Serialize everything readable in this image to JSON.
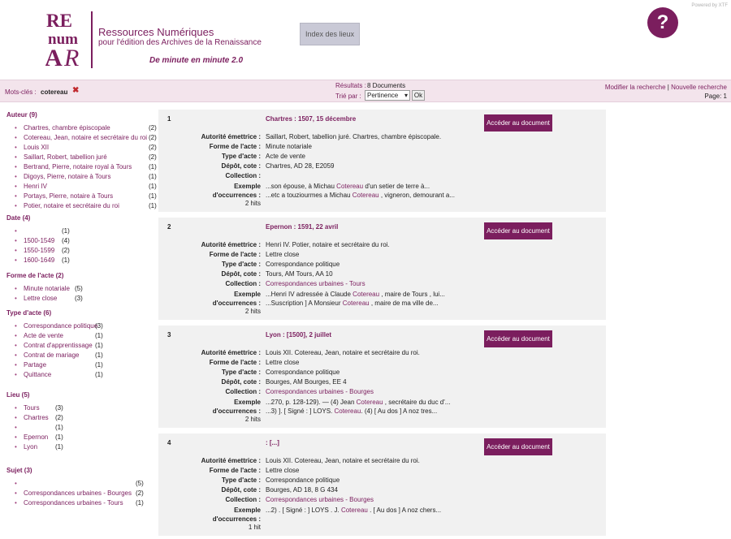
{
  "header": {
    "title": "Ressources Numériques",
    "subtitle": "pour l'édition des Archives de la Renaissance",
    "tagline": "De minute en minute 2.0",
    "index_button": "Index des lieux",
    "help_button": "?",
    "powered": "Powered by XTF"
  },
  "search": {
    "keywords_label": "Mots-clés :",
    "keyword": "cotereau",
    "remove": "✖",
    "results_label": "Résultats :",
    "results_value": "8 Documents",
    "sort_label": "Trié par :",
    "sort_value": "Pertinence",
    "ok": "Ok",
    "modify": "Modifier la recherche",
    "separator": "|",
    "new_search": "Nouvelle recherche",
    "page": "Page: 1"
  },
  "facets": [
    {
      "title": "Auteur (9)",
      "items": [
        {
          "label": "Chartres, chambre épiscopale",
          "count": "(2)"
        },
        {
          "label": "Cotereau, Jean, notaire et secrétaire du roi",
          "count": "(2)"
        },
        {
          "label": "Louis XII",
          "count": "(2)"
        },
        {
          "label": "Saillart, Robert, tabellion juré",
          "count": "(2)"
        },
        {
          "label": "Bertrand, Pierre, notaire royal à Tours",
          "count": "(1)"
        },
        {
          "label": "Digoys, Pierre, notaire à Tours",
          "count": "(1)"
        },
        {
          "label": "Henri IV",
          "count": "(1)"
        },
        {
          "label": "Portays, Pierre, notaire à Tours",
          "count": "(1)"
        },
        {
          "label": "Potier, notaire et secrétaire du roi",
          "count": "(1)"
        }
      ]
    },
    {
      "title": "Date (4)",
      "items": [
        {
          "label": "",
          "count": "(1)"
        },
        {
          "label": "1500-1549",
          "count": "(4)"
        },
        {
          "label": "1550-1599",
          "count": "(2)"
        },
        {
          "label": "1600-1649",
          "count": "(1)"
        }
      ]
    },
    {
      "title": "Forme de l'acte (2)",
      "items": [
        {
          "label": "Minute notariale",
          "count": "(5)"
        },
        {
          "label": "Lettre close",
          "count": "(3)"
        }
      ]
    },
    {
      "title": "Type d'acte (6)",
      "items": [
        {
          "label": "Correspondance politique",
          "count": "(3)"
        },
        {
          "label": "Acte de vente",
          "count": "(1)"
        },
        {
          "label": "Contrat d'apprentissage",
          "count": "(1)"
        },
        {
          "label": "Contrat de mariage",
          "count": "(1)"
        },
        {
          "label": "Partage",
          "count": "(1)"
        },
        {
          "label": "Quittance",
          "count": "(1)"
        }
      ]
    },
    {
      "title": "Lieu (5)",
      "items": [
        {
          "label": "Tours",
          "count": "(3)"
        },
        {
          "label": "Chartres",
          "count": "(2)"
        },
        {
          "label": "",
          "count": "(1)"
        },
        {
          "label": "Epernon",
          "count": "(1)"
        },
        {
          "label": "Lyon",
          "count": "(1)"
        }
      ]
    },
    {
      "title": "Sujet (3)",
      "items": [
        {
          "label": "",
          "count": "(5)"
        },
        {
          "label": "Correspondances urbaines - Bourges",
          "count": "(2)"
        },
        {
          "label": "Correspondances urbaines - Tours",
          "count": "(1)"
        }
      ]
    }
  ],
  "field_labels": {
    "autorite": "Autorité émettrice :",
    "forme": "Forme de l'acte :",
    "type": "Type d'acte :",
    "depot": "Dépôt, cote :",
    "collection": "Collection :",
    "exemple": "Exemple",
    "occurrences": "d'occurrences :"
  },
  "access_button": "Accéder au document",
  "results": [
    {
      "num": "1",
      "title": "Chartres : 1507, 15 décembre",
      "autorite": "Saillart, Robert, tabellion juré. Chartres, chambre épiscopale.",
      "forme": "Minute notariale",
      "type": "Acte de vente",
      "depot": "Chartres, AD 28, E2059",
      "collection": "",
      "snippets": [
        {
          "pre": "...son épouse, à Michau ",
          "kw": "Cotereau",
          "post": " d'un setier de terre à..."
        },
        {
          "pre": "...etc a touziourmes a Michau ",
          "kw": "Cotereau",
          "post": " , vigneron, demourant a..."
        }
      ],
      "hits": "2 hits"
    },
    {
      "num": "2",
      "title": "Epernon : 1591, 22 avril",
      "autorite": "Henri IV. Potier, notaire et secrétaire du roi.",
      "forme": "Lettre close",
      "type": "Correspondance politique",
      "depot": "Tours, AM Tours, AA 10",
      "collection": "Correspondances urbaines - Tours",
      "snippets": [
        {
          "pre": "...Henri IV adressée à Claude ",
          "kw": "Cotereau",
          "post": " , maire de Tours , lui..."
        },
        {
          "pre": "...Suscription ] A Monsieur ",
          "kw": "Cotereau",
          "post": " , maire de ma ville de..."
        }
      ],
      "hits": "2 hits"
    },
    {
      "num": "3",
      "title": "Lyon : [1500], 2 juillet",
      "autorite": "Louis XII. Cotereau, Jean, notaire et secrétaire du roi.",
      "forme": "Lettre close",
      "type": "Correspondance politique",
      "depot": "Bourges, AM Bourges, EE 4",
      "collection": "Correspondances urbaines - Bourges",
      "snippets": [
        {
          "pre": "...270, p. 128-129). — (4) Jean ",
          "kw": "Cotereau",
          "post": " , secrétaire du duc d'..."
        },
        {
          "pre": "...3) ]. [ Signé : ] LOYS. ",
          "kw": "Cotereau",
          "post": ". (4) [ Au dos ] A noz tres..."
        }
      ],
      "hits": "2 hits"
    },
    {
      "num": "4",
      "title": ": [...]",
      "autorite": "Louis XII. Cotereau, Jean, notaire et secrétaire du roi.",
      "forme": "Lettre close",
      "type": "Correspondance politique",
      "depot": "Bourges, AD 18, 8 G 434",
      "collection": "Correspondances urbaines - Bourges",
      "snippets": [
        {
          "pre": "...2) . [ Signé : ] LOYS . J. ",
          "kw": "Cotereau",
          "post": " . [ Au dos ] A noz chers..."
        }
      ],
      "hits": "1 hit"
    }
  ],
  "colors": {
    "accent": "#7b1e5e",
    "bar": "#f3e4ec",
    "card": "#f1f1f1"
  }
}
